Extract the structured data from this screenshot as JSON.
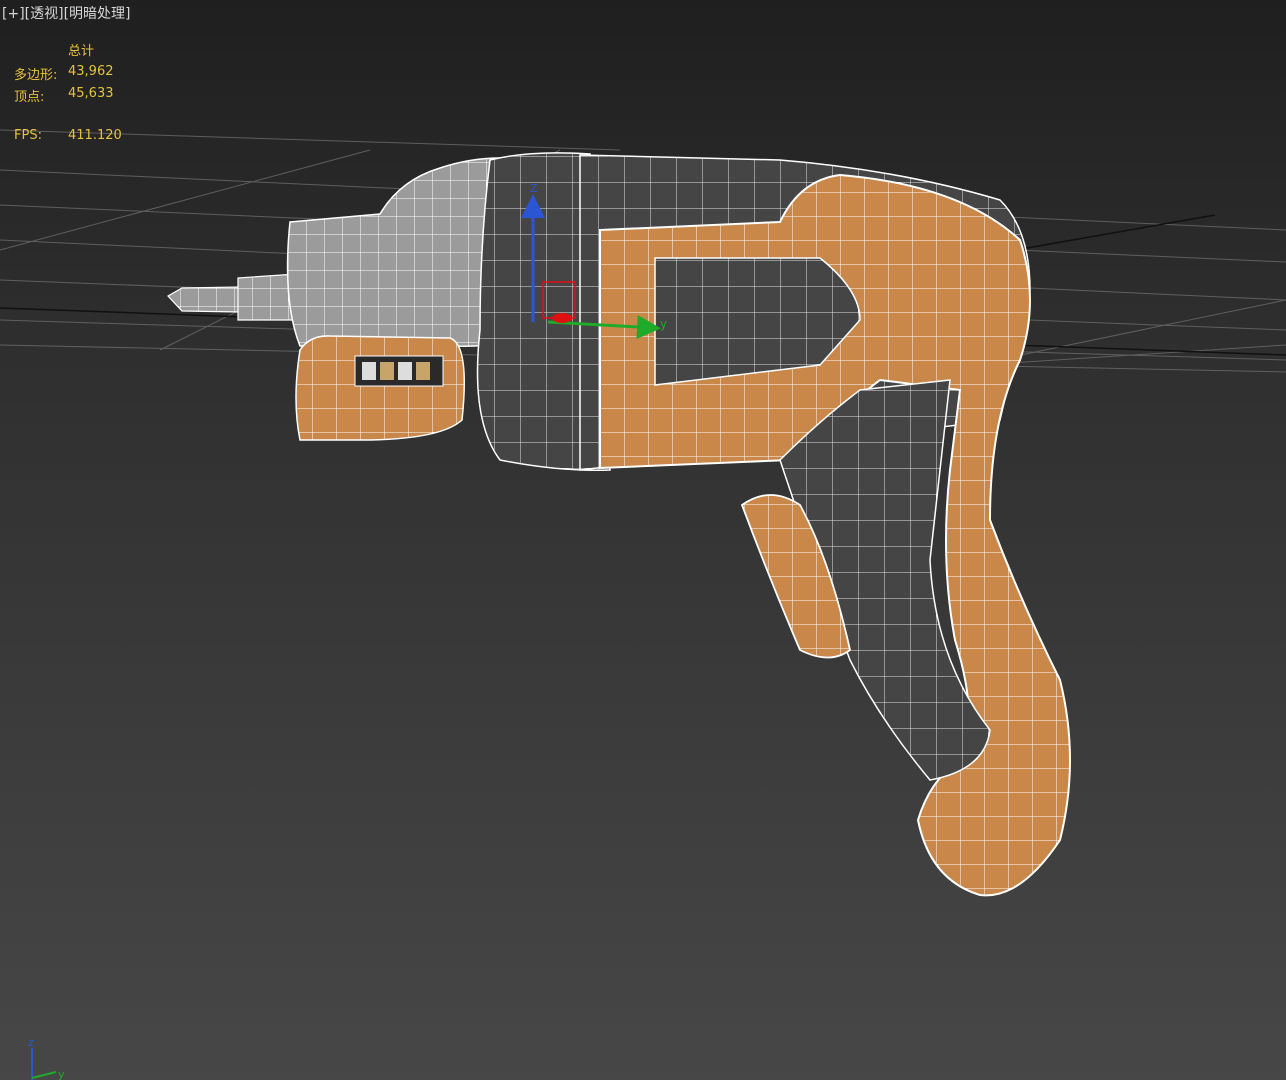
{
  "viewport": {
    "labels": [
      "[+]",
      "[透视]",
      "[明暗处理]"
    ]
  },
  "stats": {
    "header": "总计",
    "polygons_label": "多边形:",
    "polygons_value": "43,962",
    "vertices_label": "顶点:",
    "vertices_value": "45,633",
    "fps_label": "FPS:",
    "fps_value": "411.120"
  },
  "gizmo": {
    "z_label": "Z",
    "y_label": "y"
  },
  "corner_axis": {
    "z_label": "z",
    "y_label": "y"
  },
  "colors": {
    "background_top": "#1f1f1f",
    "background_bottom": "#474747",
    "stats_text": "#e8c23a",
    "model_orange": "#c9874a",
    "model_gray": "#4b4b4b",
    "model_light": "#b9b9b9",
    "wire": "#ffffff"
  }
}
